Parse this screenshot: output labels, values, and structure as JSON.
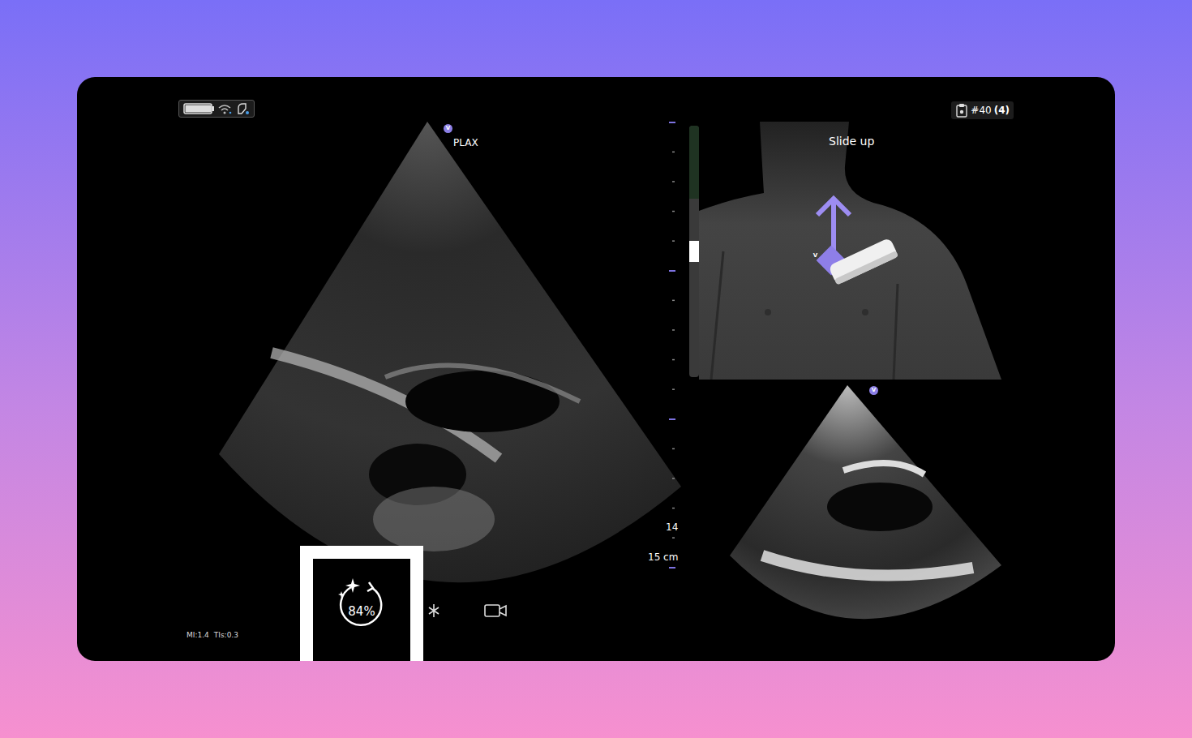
{
  "status": {
    "battery": {
      "level": 1
    }
  },
  "imaging": {
    "marker": "V",
    "view": "PLAX"
  },
  "depth_scale": {
    "labels": [
      "14",
      "15 cm"
    ]
  },
  "auto_button": {
    "reading": "84%"
  },
  "output": [
    "MI:1.4",
    "TIs:0.3"
  ],
  "clip_counter": {
    "number": "#40",
    "count": "(4)"
  },
  "guidance": {
    "instruction": "Slide up",
    "marker": "V",
    "quality": {
      "level": 0.5
    }
  },
  "reference": {
    "marker": "V"
  }
}
